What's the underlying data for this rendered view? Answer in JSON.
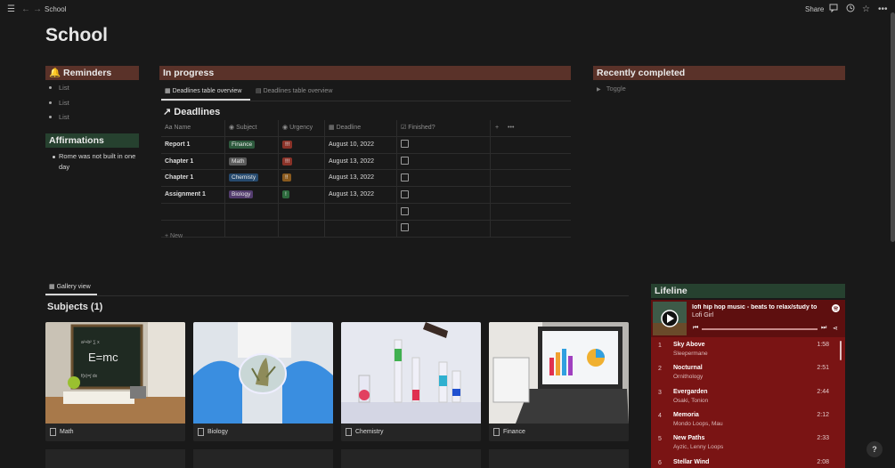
{
  "topbar": {
    "breadcrumb": "School",
    "share": "Share"
  },
  "page": {
    "title": "School"
  },
  "reminders": {
    "title": "Reminders",
    "items": [
      "List",
      "List",
      "List"
    ]
  },
  "affirmations": {
    "title": "Affirmations",
    "items": [
      "Rome was not built in one day"
    ]
  },
  "in_progress": {
    "title": "In progress",
    "tabs": [
      "Deadlines table overview",
      "Deadlines table overview"
    ],
    "db_title": "Deadlines",
    "columns": [
      "Name",
      "Subject",
      "Urgency",
      "Deadline",
      "Finished?"
    ],
    "rows": [
      {
        "name": "Report 1",
        "subject": "Finance",
        "subject_color": "#2d5a3d",
        "urgency": "!!!",
        "urgency_color": "#8a3228",
        "deadline": "August 10, 2022"
      },
      {
        "name": "Chapter 1",
        "subject": "Math",
        "subject_color": "#5a5a5a",
        "urgency": "!!!",
        "urgency_color": "#8a3228",
        "deadline": "August 13, 2022"
      },
      {
        "name": "Chapter 1",
        "subject": "Chemisty",
        "subject_color": "#264a6e",
        "urgency": "!!",
        "urgency_color": "#8a5a1e",
        "deadline": "August 13, 2022"
      },
      {
        "name": "Assignment 1",
        "subject": "Biology",
        "subject_color": "#533c6e",
        "urgency": "!",
        "urgency_color": "#2d6a3d",
        "deadline": "August 13, 2022"
      },
      {
        "name": "",
        "subject": "",
        "urgency": "",
        "deadline": ""
      },
      {
        "name": "",
        "subject": "",
        "urgency": "",
        "deadline": ""
      }
    ],
    "new_label": "New"
  },
  "recently_completed": {
    "title": "Recently completed",
    "toggle": "Toggle"
  },
  "gallery": {
    "tab": "Gallery view",
    "title": "Subjects (1)",
    "cards": [
      "Math",
      "Biology",
      "Chemistry",
      "Finance"
    ]
  },
  "lifeline": {
    "title": "Lifeline",
    "playlist_title": "lofi hip hop music - beats to relax/study to",
    "playlist_owner": "Lofi Girl",
    "tracks": [
      {
        "n": "1",
        "title": "Sky Above",
        "artist": "Sleepermane",
        "dur": "1:58"
      },
      {
        "n": "2",
        "title": "Nocturnal",
        "artist": "Ornithology",
        "dur": "2:51"
      },
      {
        "n": "3",
        "title": "Evergarden",
        "artist": "Osaki, Tonion",
        "dur": "2:44"
      },
      {
        "n": "4",
        "title": "Memoria",
        "artist": "Mondo Loops, Mau",
        "dur": "2:12"
      },
      {
        "n": "5",
        "title": "New Paths",
        "artist": "Ayzic, Lenny Loops",
        "dur": "2:33"
      },
      {
        "n": "6",
        "title": "Stellar Wind",
        "artist": "",
        "dur": "2:08"
      }
    ]
  },
  "help": "?",
  "colors": {
    "background": "#191919",
    "brown_header": "#5a3229",
    "green_header": "#26412f",
    "spotify_red": "#7a1414"
  }
}
